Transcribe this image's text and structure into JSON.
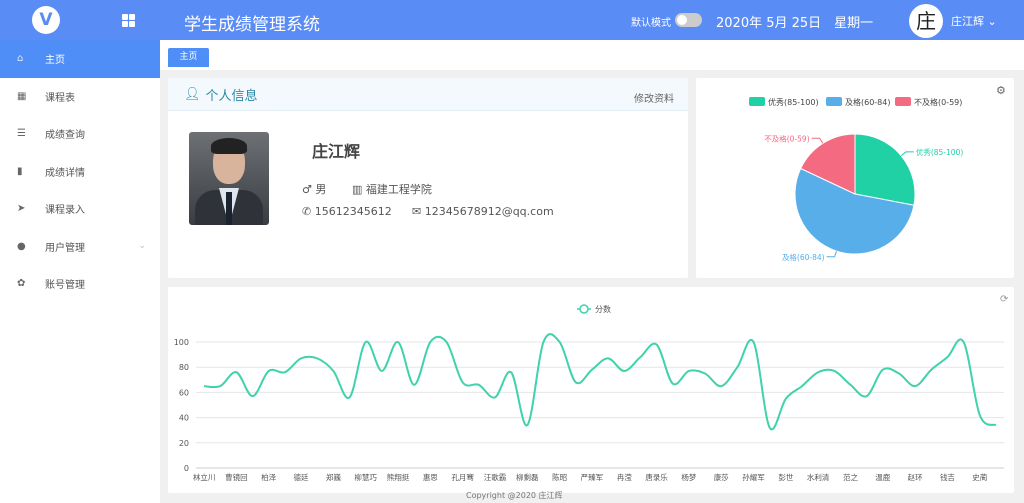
{
  "header": {
    "logo": "V",
    "title": "学生成绩管理系统",
    "mode_label": "默认模式",
    "date": "2020年 5月 25日　星期一",
    "avatar_char": "庄",
    "user_name": "庄江辉"
  },
  "sidebar": {
    "items": [
      {
        "label": "主页",
        "icon": "⌂",
        "active": true
      },
      {
        "label": "课程表",
        "icon": "▦"
      },
      {
        "label": "成绩查询",
        "icon": "☰"
      },
      {
        "label": "成绩详情",
        "icon": "▮"
      },
      {
        "label": "课程录入",
        "icon": "➤"
      },
      {
        "label": "用户管理",
        "icon": "●",
        "expandable": true
      },
      {
        "label": "账号管理",
        "icon": "✿"
      }
    ]
  },
  "tabs": [
    {
      "label": "主页"
    }
  ],
  "profile": {
    "title": "个人信息",
    "edit_label": "修改资料",
    "name": "庄江辉",
    "gender": "男",
    "college": "福建工程学院",
    "phone": "15612345612",
    "email": "12345678912@qq.com"
  },
  "footer": {
    "copyright": "Copyright @2020 庄江辉"
  },
  "colors": {
    "primary": "#4f8ef7",
    "excellent": "#1fd1a5",
    "pass": "#58aee9",
    "fail": "#f46a80",
    "line": "#3fd2ab"
  },
  "chart_data": [
    {
      "type": "pie",
      "legend_position": "top",
      "labels": [
        "优秀(85-100)",
        "及格(60-84)",
        "不及格(0-59)"
      ],
      "values": [
        14,
        27,
        9
      ]
    },
    {
      "type": "line",
      "smooth": true,
      "legend_position": "top",
      "series": [
        {
          "name": "分数",
          "values": [
            65,
            65,
            76,
            57,
            77,
            76,
            87,
            87,
            77,
            56,
            100,
            77,
            100,
            66,
            100,
            100,
            68,
            66,
            56,
            76,
            34,
            100,
            100,
            68,
            78,
            87,
            77,
            88,
            98,
            67,
            77,
            75,
            65,
            80,
            100,
            32,
            55,
            65,
            76,
            77,
            66,
            57,
            78,
            75,
            65,
            78,
            88,
            100,
            42,
            34
          ]
        }
      ],
      "categories": [
        "林立川",
        "",
        "曹镜回",
        "",
        "柏泽",
        "",
        "德廷",
        "",
        "郑巍",
        "",
        "柳慧巧",
        "",
        "熊翔挺",
        "",
        "惠思",
        "",
        "孔月骞",
        "",
        "汪歌霸",
        "",
        "柳剩磊",
        "",
        "陈昭",
        "",
        "严臻军",
        "",
        "冉滢",
        "",
        "唐录乐",
        "",
        "杨梦",
        "",
        "康莎",
        "",
        "孙耀军",
        "",
        "彭世",
        "",
        "水利清",
        "",
        "范之",
        "",
        "温鹿",
        "",
        "赵环",
        "",
        "钱吉",
        "",
        "史蔺",
        ""
      ],
      "ylim": [
        0,
        100
      ],
      "yticks": [
        0,
        20,
        40,
        60,
        80,
        100
      ],
      "grid": true
    }
  ]
}
